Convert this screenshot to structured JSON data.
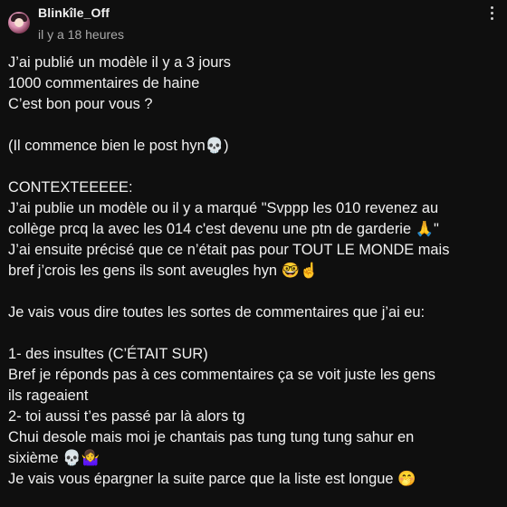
{
  "post": {
    "author": "Blinkîle_Off",
    "time": "il y a 18 heures",
    "lines": [
      "J’ai publié un modèle il y a 3 jours",
      "1000 commentaires de haine",
      "C’est bon pour vous ?",
      "",
      "(Il commence bien le post hyn💀)",
      "",
      "CONTEXTEEEEE:",
      "J’ai publie un modèle ou il y a marqué \"Svppp les 010 revenez au",
      "collège prcq la avec les 014 c'est devenu une ptn de garderie 🙏\"",
      "J’ai ensuite précisé que ce n’était pas pour TOUT LE MONDE mais",
      "bref j’crois les gens ils sont aveugles hyn 🤓☝️",
      "",
      "Je vais vous dire toutes les sortes de commentaires que j’ai eu:",
      "",
      "1- des insultes (C’ÉTAIT SUR)",
      "Bref je réponds pas à ces commentaires ça se voit juste les gens",
      "ils rageaient",
      "2- toi aussi t’es passé par là alors tg",
      "Chui desole mais moi je chantais pas tung tung tung sahur en",
      "sixième 💀🤷‍♀️",
      "Je vais vous épargner la suite parce que la liste est longue 🤭"
    ]
  },
  "icons": {
    "avatar": "avatar-image",
    "menu": "more-vertical-icon"
  }
}
